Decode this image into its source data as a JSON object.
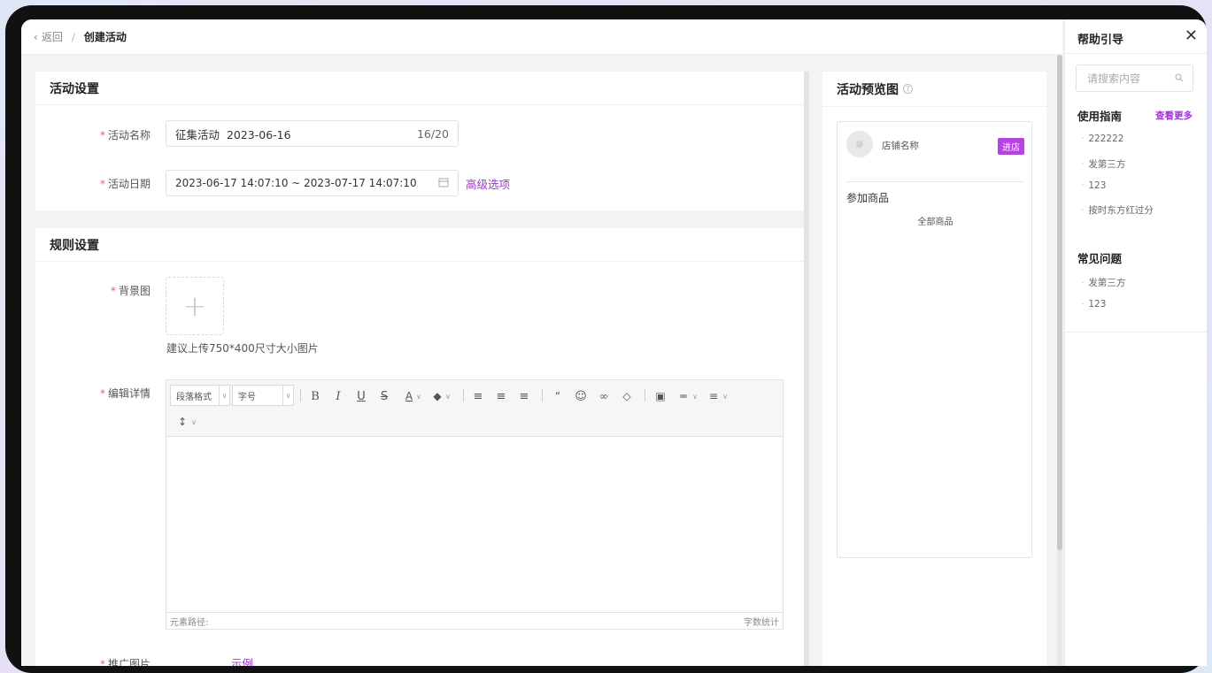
{
  "breadcrumb": {
    "back": "返回",
    "separator": "/",
    "current": "创建活动"
  },
  "activity_settings": {
    "title": "活动设置",
    "name_label": "活动名称",
    "name_value": "征集活动  2023-06-16",
    "name_count": "16/20",
    "date_label": "活动日期",
    "date_value": "2023-06-17 14:07:10 ~ 2023-07-17 14:07:10",
    "advanced_link": "高级选项"
  },
  "rule_settings": {
    "title": "规则设置",
    "bg_label": "背景图",
    "bg_hint": "建议上传750*400尺寸大小图片",
    "detail_label": "编辑详情",
    "editor": {
      "format_select": "段落格式",
      "size_select": "字号",
      "path_label": "元素路径:",
      "word_count": "字数统计"
    },
    "promo_label": "推广图片",
    "example_link": "示例"
  },
  "preview": {
    "title": "活动预览图",
    "shop_name": "店铺名称",
    "enter_shop": "进店",
    "products_label": "参加商品",
    "all_products": "全部商品"
  },
  "help_panel": {
    "title": "帮助引导",
    "search_placeholder": "请搜索内容",
    "guide_title": "使用指南",
    "view_more": "查看更多",
    "guide_items": [
      "222222",
      "发第三方",
      "123",
      "按时东方红过分"
    ],
    "faq_title": "常见问题",
    "faq_items": [
      "发第三方",
      "123"
    ]
  },
  "colors": {
    "accent": "#a034d6",
    "required_star": "#e45b8b",
    "shop_button": "#b344e0"
  }
}
